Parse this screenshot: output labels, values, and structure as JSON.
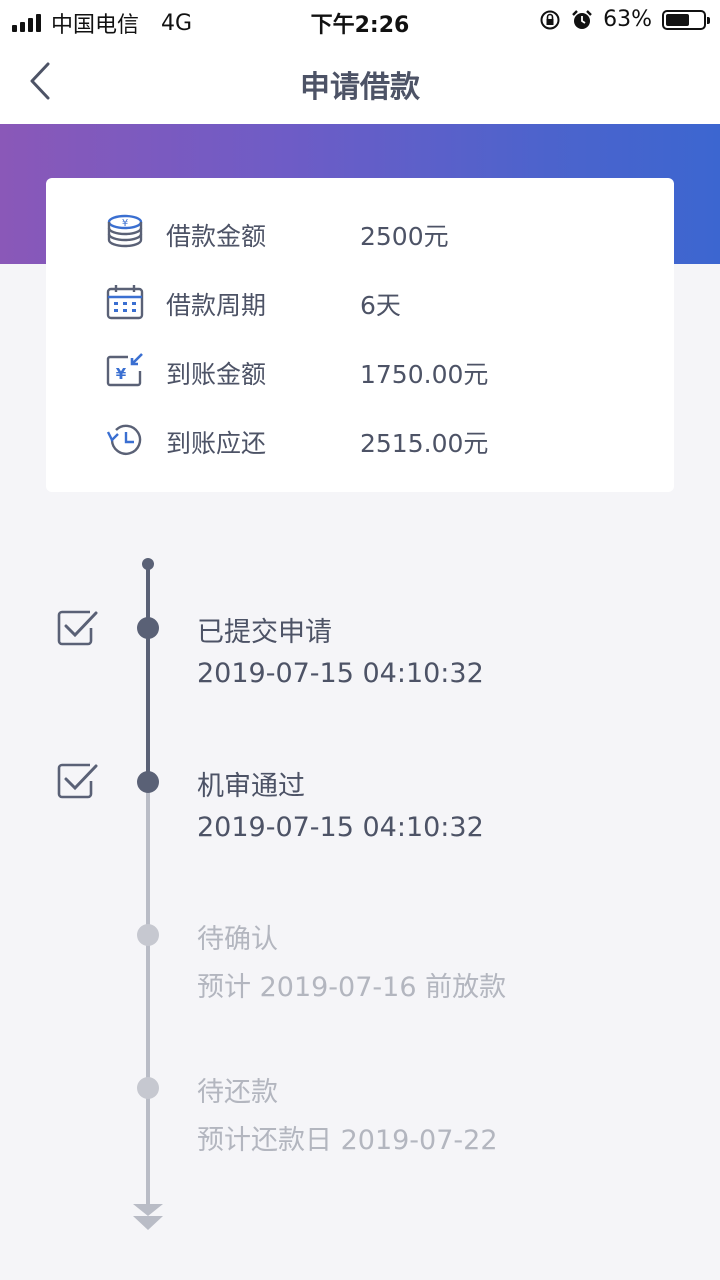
{
  "status_bar": {
    "carrier": "中国电信",
    "network": "4G",
    "time": "下午2:26",
    "battery_percent_text": "63%",
    "battery_level": 0.63,
    "icons": [
      "signal-icon",
      "rotation-lock-icon",
      "alarm-icon",
      "battery-icon"
    ]
  },
  "nav": {
    "title": "申请借款",
    "back_icon": "chevron-left-icon"
  },
  "colors": {
    "banner_gradient_start": "#8a58b8",
    "banner_gradient_end": "#3c66d0",
    "accent_blue": "#3a6fd1",
    "done_gray": "#5a6176",
    "pending_gray": "#b9bcc6"
  },
  "loan_info": [
    {
      "icon": "coin-stack-icon",
      "label": "借款金额",
      "value": "2500元"
    },
    {
      "icon": "calendar-icon",
      "label": "借款周期",
      "value": "6天"
    },
    {
      "icon": "yuan-receive-icon",
      "label": "到账金额",
      "value": "1750.00元"
    },
    {
      "icon": "clock-history-icon",
      "label": "到账应还",
      "value": "2515.00元"
    }
  ],
  "timeline": [
    {
      "title": "已提交申请",
      "subtitle": "2019-07-15 04:10:32",
      "done": true
    },
    {
      "title": "机审通过",
      "subtitle": "2019-07-15 04:10:32",
      "done": true
    },
    {
      "title": "待确认",
      "subtitle": "预计 2019-07-16 前放款",
      "done": false
    },
    {
      "title": "待还款",
      "subtitle": "预计还款日 2019-07-22",
      "done": false
    }
  ]
}
